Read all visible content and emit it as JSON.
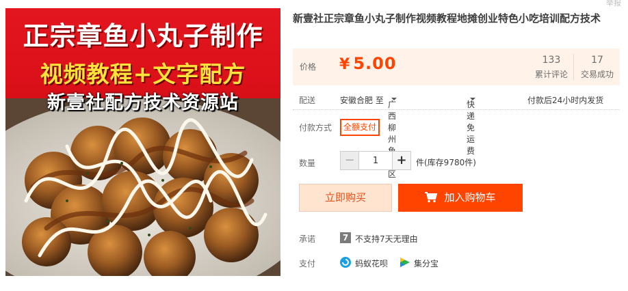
{
  "product": {
    "title": "新壹社正宗章鱼小丸子制作视频教程地摊创业特色小吃培训配方技术",
    "banner": {
      "line1": "正宗章鱼小丸子制作",
      "line2": "视频教程+文字配方",
      "line3": "新壹社配方技术资源站"
    }
  },
  "ticker": "举报",
  "price": {
    "label": "价格",
    "currency": "¥",
    "value": "5.00"
  },
  "stats": {
    "reviews_count": "133",
    "reviews_label": "累计评论",
    "sales_count": "17",
    "sales_label": "交易成功"
  },
  "delivery": {
    "label": "配送",
    "from": "安徽合肥 至",
    "to": "广西柳州鱼峰区",
    "shipping": "快递 免运费",
    "ship_time": "付款后24小时内发货"
  },
  "payment_method": {
    "label": "付款方式",
    "option": "全额支付"
  },
  "quantity": {
    "label": "数量",
    "minus": "−",
    "value": "1",
    "plus": "+",
    "stock": "件(库存9780件)"
  },
  "actions": {
    "buy_now": "立即购买",
    "add_to_cart": "加入购物车"
  },
  "promise": {
    "label": "承诺",
    "icon_glyph": "7",
    "text": "不支持7天无理由"
  },
  "pay": {
    "label": "支付",
    "huabei": "蚂蚁花呗",
    "jifenbao": "集分宝"
  },
  "colors": {
    "accent": "#ff4400",
    "price": "#ff4400",
    "price_panel_bg": "#fff2e8",
    "banner_red": "#e3161f",
    "banner_yellow": "#ffe23a"
  }
}
